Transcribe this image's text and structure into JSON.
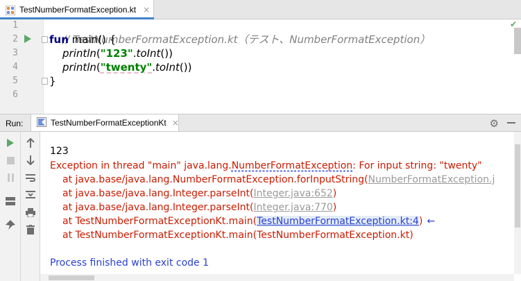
{
  "editor_tab": {
    "label": "TestNumberFormatException.kt",
    "close": "×"
  },
  "code": {
    "line_numbers": [
      "1",
      "2",
      "3",
      "4",
      "5",
      "6"
    ],
    "line1_comment": "// TestNumberFormatException.kt（テスト、NumberFormatException）",
    "line2_kw": "fun",
    "line2_rest": " main() {",
    "line3_fn": "println",
    "line3_open": "(",
    "line3_str": "\"123\"",
    "line3_dot": ".",
    "line3_call": "toInt",
    "line3_close": "())",
    "line4_fn": "println",
    "line4_open": "(",
    "line4_str": "\"twenty\"",
    "line4_dot": ".",
    "line4_call": "toInt",
    "line4_close": "())",
    "line5": "}"
  },
  "run_panel": {
    "run_label": "Run:",
    "tab_label": "TestNumberFormatExceptionKt",
    "close": "×",
    "gear": "⚙"
  },
  "console": {
    "line1": "123",
    "exc_prefix": "Exception in thread \"main\" java.lang.",
    "exc_class": "NumberFormatException",
    "exc_suffix": ": For input string: \"twenty\"",
    "st1_prefix": "at java.base/java.lang.NumberFormatException.forInputString(",
    "st1_link": "NumberFormatException.j",
    "st2_prefix": "at java.base/java.lang.Integer.parseInt(",
    "st2_link": "Integer.java:652",
    "st2_suffix": ")",
    "st3_prefix": "at java.base/java.lang.Integer.parseInt(",
    "st3_link": "Integer.java:770",
    "st3_suffix": ")",
    "st4_prefix": "at TestNumberFormatExceptionKt.main(",
    "st4_link": "TestNumberFormatException.kt:4",
    "st4_suffix": ")",
    "st4_arrow": "←",
    "st5": "at TestNumberFormatExceptionKt.main(TestNumberFormatException.kt)",
    "finished": "Process finished with exit code 1"
  },
  "colors": {
    "error": "#c91b00",
    "link": "#2a41d0",
    "keyword": "#000080",
    "string": "#008000",
    "comment": "#808080",
    "run_green": "#59a869"
  },
  "icons": [
    "kotlin-file-icon",
    "run-arrow-icon",
    "rerun-icon",
    "stop-icon",
    "pause-icon",
    "layout-icon",
    "pin-icon",
    "up-arrow-icon",
    "down-arrow-icon",
    "soft-wrap-icon",
    "scroll-to-end-icon",
    "print-icon",
    "trash-icon",
    "gear-icon",
    "minimize-icon"
  ]
}
